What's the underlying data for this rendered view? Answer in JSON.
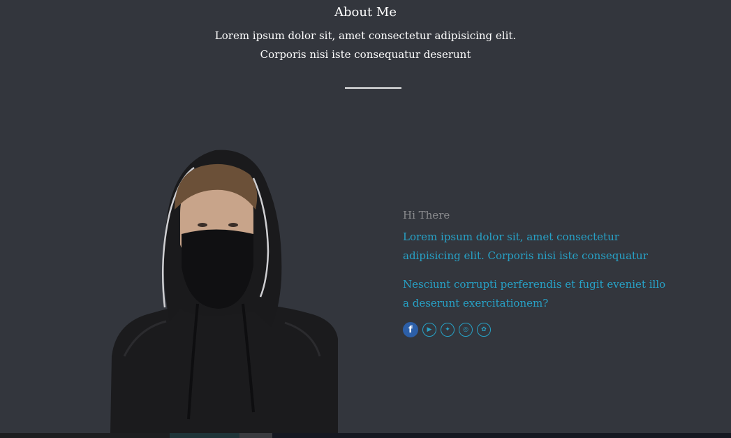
{
  "section": {
    "title": "About Me",
    "intro_line1": "Lorem ipsum dolor sit, amet consectetur adipisicing elit.",
    "intro_line2": "Corporis nisi iste consequatur deserunt"
  },
  "about": {
    "greeting": "Hi There",
    "paragraph1": "Lorem ipsum dolor sit, amet consectetur adipisicing elit. Corporis nisi iste consequatur",
    "paragraph2": "Nesciunt corrupti perferendis et fugit eveniet illo a deserunt exercitationem?"
  },
  "socials": [
    {
      "name": "facebook-icon",
      "glyph": "f"
    },
    {
      "name": "youtube-icon",
      "glyph": "▶"
    },
    {
      "name": "twitter-icon",
      "glyph": "✦"
    },
    {
      "name": "instagram-icon",
      "glyph": "◎"
    },
    {
      "name": "dribbble-icon",
      "glyph": "✿"
    }
  ],
  "colors": {
    "background": "#33363d",
    "accent": "#27a2c7",
    "muted": "#8a8b8e",
    "facebook": "#2c5fa8"
  }
}
